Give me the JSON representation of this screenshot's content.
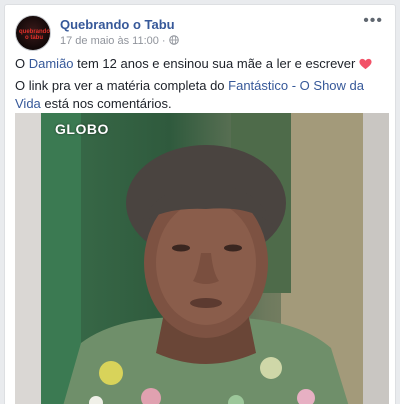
{
  "post": {
    "page_name": "Quebrando o Tabu",
    "avatar_text": "quebrando o tabu",
    "timestamp": "17 de maio às 11:00",
    "separator": " · ",
    "more_label": "•••",
    "line1_prefix": "O ",
    "line1_link": "Damião",
    "line1_suffix": " tem 12 anos e ensinou sua mãe a ler e escrever ",
    "line2_prefix": "O link pra ver a matéria completa do ",
    "line2_link": "Fantástico - O Show da Vida",
    "line2_suffix": " está nos comentários."
  },
  "media": {
    "watermark": "GLOBO"
  },
  "colors": {
    "link": "#365899",
    "heart": "#f25268"
  },
  "icons": [
    "globe-icon",
    "heart-icon",
    "more-options-icon"
  ]
}
